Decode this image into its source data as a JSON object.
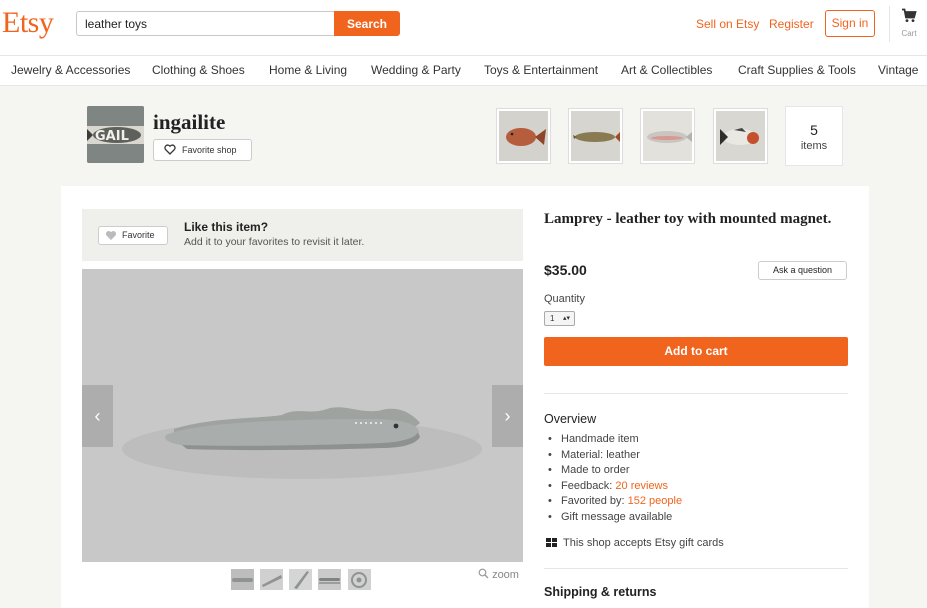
{
  "header": {
    "logo": "Etsy",
    "search_value": "leather toys",
    "search_button": "Search",
    "sell_link": "Sell on Etsy",
    "register_link": "Register",
    "signin_button": "Sign in",
    "cart_label": "Cart"
  },
  "categories": [
    "Jewelry & Accessories",
    "Clothing & Shoes",
    "Home & Living",
    "Wedding & Party",
    "Toys & Entertainment",
    "Art & Collectibles",
    "Craft Supplies & Tools",
    "Vintage"
  ],
  "shop": {
    "avatar_text": "GAIL",
    "name": "ingailite",
    "favorite_shop_label": "Favorite shop",
    "items_count": "5",
    "items_label": "items"
  },
  "like": {
    "favorite_label": "Favorite",
    "title": "Like this item?",
    "subtitle": "Add it to your favorites to revisit it later."
  },
  "gallery": {
    "zoom_label": "zoom",
    "prev_arrow": "‹",
    "next_arrow": "›"
  },
  "product": {
    "title": "Lamprey - leather toy with mounted magnet.",
    "price": "$35.00",
    "ask_question": "Ask a question",
    "quantity_label": "Quantity",
    "quantity_value": "1",
    "add_to_cart": "Add to cart"
  },
  "overview": {
    "title": "Overview",
    "items": [
      {
        "text": "Handmade item",
        "link": ""
      },
      {
        "text": "Material: leather",
        "link": ""
      },
      {
        "text": "Made to order",
        "link": ""
      },
      {
        "text": "Feedback: ",
        "link": "20 reviews"
      },
      {
        "text": "Favorited by: ",
        "link": "152 people"
      },
      {
        "text": "Gift message available",
        "link": ""
      }
    ],
    "gift_cards": "This shop accepts Etsy gift cards"
  },
  "shipping": {
    "title": "Shipping & returns"
  },
  "colors": {
    "accent": "#f1641e",
    "background": "#f5f5f1"
  }
}
